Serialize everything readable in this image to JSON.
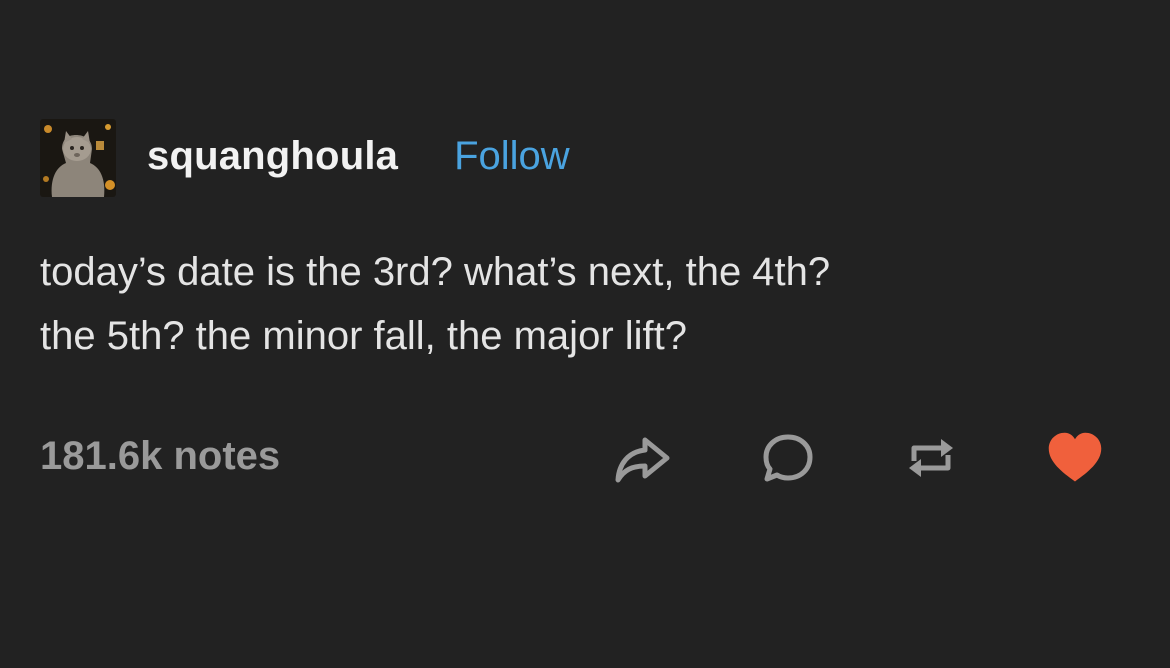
{
  "post": {
    "username": "squanghoula",
    "follow_label": "Follow",
    "body_lines": [
      "today’s date is the 3rd? what’s next, the 4th?",
      "the 5th? the minor fall, the major lift?"
    ],
    "notes": "181.6k notes",
    "actions": [
      {
        "name": "share",
        "icon": "share-icon"
      },
      {
        "name": "reply",
        "icon": "reply-icon"
      },
      {
        "name": "reblog",
        "icon": "reblog-icon"
      },
      {
        "name": "like",
        "icon": "heart-icon",
        "active": true
      }
    ]
  },
  "colors": {
    "background": "#222222",
    "text": "#e4e4e4",
    "follow": "#4aa3e0",
    "muted": "#9a9a9a",
    "like": "#f0603c"
  }
}
